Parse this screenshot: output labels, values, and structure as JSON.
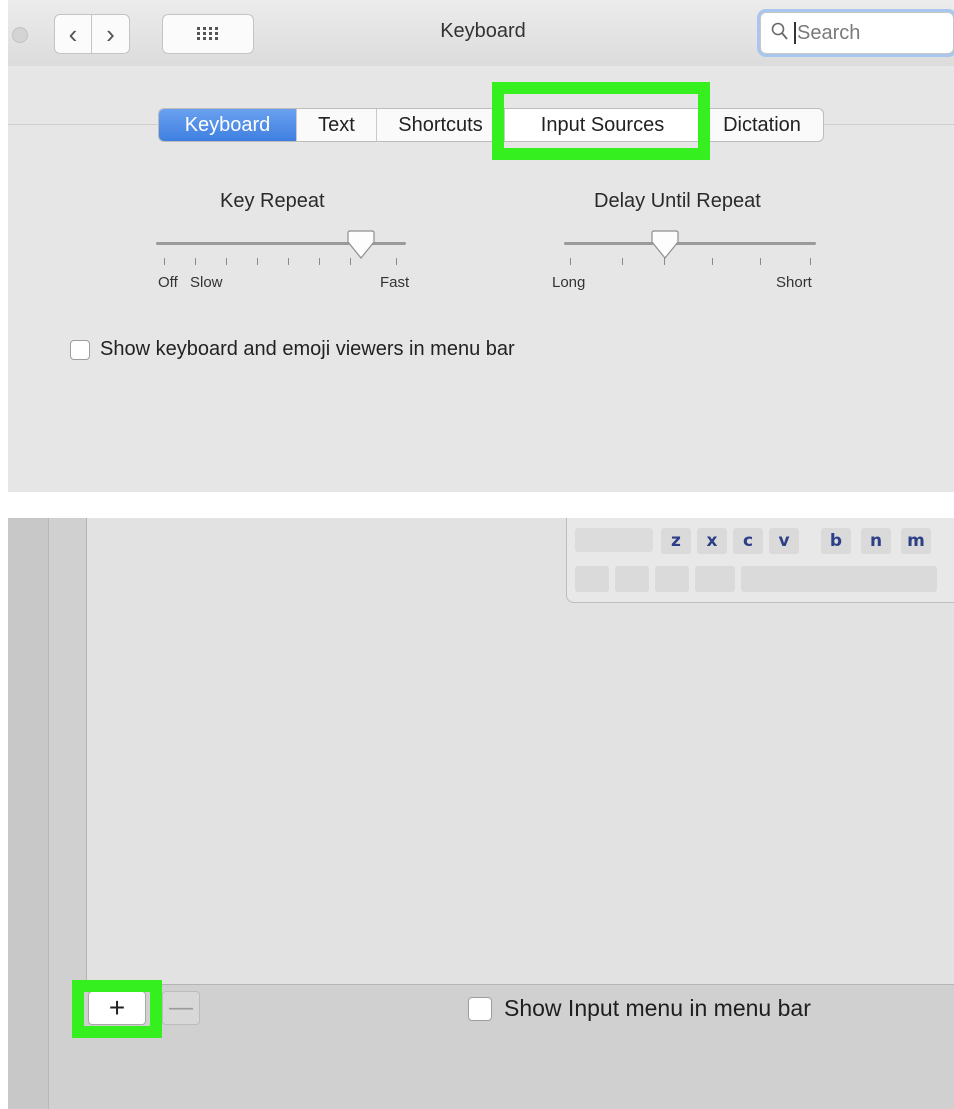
{
  "window": {
    "title": "Keyboard",
    "search_placeholder": "Search"
  },
  "tabs": [
    {
      "label": "Keyboard",
      "state": "selected"
    },
    {
      "label": "Text"
    },
    {
      "label": "Shortcuts"
    },
    {
      "label": "Input Sources",
      "highlighted": true
    },
    {
      "label": "Dictation"
    }
  ],
  "key_repeat": {
    "title": "Key Repeat",
    "labels": [
      "Off",
      "Slow",
      "Fast"
    ],
    "value_fraction": 0.82
  },
  "delay_until_repeat": {
    "title": "Delay Until Repeat",
    "labels": [
      "Long",
      "Short"
    ],
    "value_fraction": 0.4
  },
  "checkbox_viewers": {
    "label": "Show keyboard and emoji viewers in menu bar",
    "checked": false
  },
  "keyboard_preview": {
    "keys": [
      "z",
      "x",
      "c",
      "v",
      "b",
      "n",
      "m"
    ]
  },
  "bottom": {
    "add_label": "+",
    "remove_label": "—",
    "show_input_menu": {
      "label": "Show Input menu in menu bar",
      "checked": false
    }
  },
  "colors": {
    "highlight": "#35ef1e",
    "selected_tab": "#3f7fe0",
    "key_letter": "#2d3f86"
  }
}
